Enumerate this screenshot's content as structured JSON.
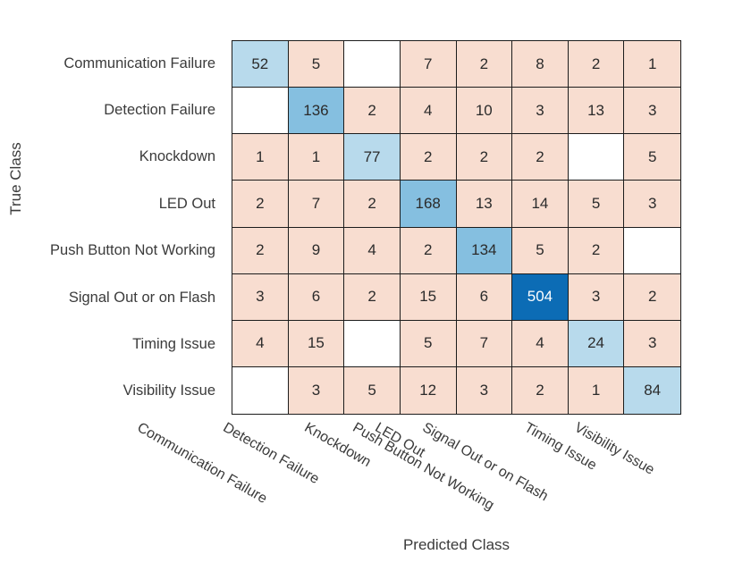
{
  "axes": {
    "x_title": "Predicted Class",
    "y_title": "True Class"
  },
  "colors": {
    "diagonal_strong": "#0c6cb5",
    "diagonal_medium": "#85bfe0",
    "diagonal_light": "#b8daec",
    "offdiagonal": "#f8ddd0",
    "empty": "#ffffff",
    "grid_line": "#1c1c1c",
    "text": "#2b2b2b",
    "label_text": "#3b3b3b",
    "value_text_on_strong": "#ffffff"
  },
  "chart_data": {
    "type": "heatmap",
    "title": "",
    "xlabel": "Predicted Class",
    "ylabel": "True Class",
    "grid": true,
    "legend": "none",
    "classes": [
      "Communication Failure",
      "Detection Failure",
      "Knockdown",
      "LED Out",
      "Push Button Not Working",
      "Signal Out or on Flash",
      "Timing Issue",
      "Visibility Issue"
    ],
    "row_labels": [
      "Communication Failure",
      "Detection Failure",
      "Knockdown",
      "LED Out",
      "Push Button Not Working",
      "Signal Out or on Flash",
      "Timing Issue",
      "Visibility Issue"
    ],
    "column_labels": [
      "Communication Failure",
      "Detection Failure",
      "Knockdown",
      "LED Out",
      "Push Button Not Working",
      "Signal Out or on Flash",
      "Timing Issue",
      "Visibility Issue"
    ],
    "matrix": [
      [
        52,
        5,
        null,
        7,
        2,
        8,
        2,
        1
      ],
      [
        null,
        136,
        2,
        4,
        10,
        3,
        13,
        3
      ],
      [
        1,
        1,
        77,
        2,
        2,
        2,
        null,
        5
      ],
      [
        2,
        7,
        2,
        168,
        13,
        14,
        5,
        3
      ],
      [
        2,
        9,
        4,
        2,
        134,
        5,
        2,
        null
      ],
      [
        3,
        6,
        2,
        15,
        6,
        504,
        3,
        2
      ],
      [
        4,
        15,
        null,
        5,
        7,
        4,
        24,
        3
      ],
      [
        null,
        3,
        5,
        12,
        3,
        2,
        1,
        84
      ]
    ],
    "cell_colors": [
      [
        "#b8daec",
        "#f8ddd0",
        "#ffffff",
        "#f8ddd0",
        "#f8ddd0",
        "#f8ddd0",
        "#f8ddd0",
        "#f8ddd0"
      ],
      [
        "#ffffff",
        "#85bfe0",
        "#f8ddd0",
        "#f8ddd0",
        "#f8ddd0",
        "#f8ddd0",
        "#f8ddd0",
        "#f8ddd0"
      ],
      [
        "#f8ddd0",
        "#f8ddd0",
        "#b8daec",
        "#f8ddd0",
        "#f8ddd0",
        "#f8ddd0",
        "#ffffff",
        "#f8ddd0"
      ],
      [
        "#f8ddd0",
        "#f8ddd0",
        "#f8ddd0",
        "#85bfe0",
        "#f8ddd0",
        "#f8ddd0",
        "#f8ddd0",
        "#f8ddd0"
      ],
      [
        "#f8ddd0",
        "#f8ddd0",
        "#f8ddd0",
        "#f8ddd0",
        "#85bfe0",
        "#f8ddd0",
        "#f8ddd0",
        "#ffffff"
      ],
      [
        "#f8ddd0",
        "#f8ddd0",
        "#f8ddd0",
        "#f8ddd0",
        "#f8ddd0",
        "#0c6cb5",
        "#f8ddd0",
        "#f8ddd0"
      ],
      [
        "#f8ddd0",
        "#f8ddd0",
        "#ffffff",
        "#f8ddd0",
        "#f8ddd0",
        "#f8ddd0",
        "#b8daec",
        "#f8ddd0"
      ],
      [
        "#ffffff",
        "#f8ddd0",
        "#f8ddd0",
        "#f8ddd0",
        "#f8ddd0",
        "#f8ddd0",
        "#f8ddd0",
        "#b8daec"
      ]
    ],
    "cell_text_colors": [
      [
        "#2b2b2b",
        "#2b2b2b",
        "#2b2b2b",
        "#2b2b2b",
        "#2b2b2b",
        "#2b2b2b",
        "#2b2b2b",
        "#2b2b2b"
      ],
      [
        "#2b2b2b",
        "#2b2b2b",
        "#2b2b2b",
        "#2b2b2b",
        "#2b2b2b",
        "#2b2b2b",
        "#2b2b2b",
        "#2b2b2b"
      ],
      [
        "#2b2b2b",
        "#2b2b2b",
        "#2b2b2b",
        "#2b2b2b",
        "#2b2b2b",
        "#2b2b2b",
        "#2b2b2b",
        "#2b2b2b"
      ],
      [
        "#2b2b2b",
        "#2b2b2b",
        "#2b2b2b",
        "#2b2b2b",
        "#2b2b2b",
        "#2b2b2b",
        "#2b2b2b",
        "#2b2b2b"
      ],
      [
        "#2b2b2b",
        "#2b2b2b",
        "#2b2b2b",
        "#2b2b2b",
        "#2b2b2b",
        "#2b2b2b",
        "#2b2b2b",
        "#2b2b2b"
      ],
      [
        "#2b2b2b",
        "#2b2b2b",
        "#2b2b2b",
        "#2b2b2b",
        "#2b2b2b",
        "#ffffff",
        "#2b2b2b",
        "#2b2b2b"
      ],
      [
        "#2b2b2b",
        "#2b2b2b",
        "#2b2b2b",
        "#2b2b2b",
        "#2b2b2b",
        "#2b2b2b",
        "#2b2b2b",
        "#2b2b2b"
      ],
      [
        "#2b2b2b",
        "#2b2b2b",
        "#2b2b2b",
        "#2b2b2b",
        "#2b2b2b",
        "#2b2b2b",
        "#2b2b2b",
        "#2b2b2b"
      ]
    ]
  }
}
